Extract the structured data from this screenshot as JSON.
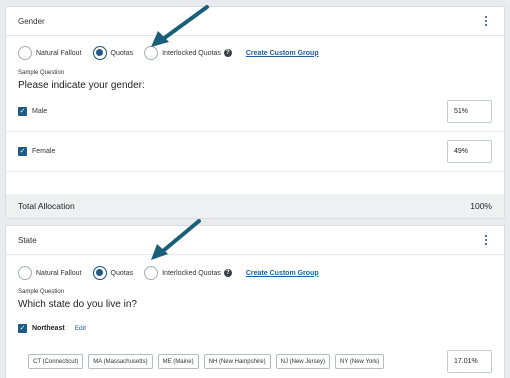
{
  "gender_card": {
    "title": "Gender",
    "options": {
      "natural_fallout": "Natural Fallout",
      "quotas": "Quotas",
      "interlocked": "Interlocked Quotas"
    },
    "help_glyph": "?",
    "custom_group_link": "Create Custom Group",
    "sample_label": "Sample Question",
    "question": "Please indicate your gender:",
    "answers": [
      {
        "label": "Male",
        "checked": true,
        "value": "51%"
      },
      {
        "label": "Female",
        "checked": true,
        "value": "49%"
      }
    ],
    "total_label": "Total Allocation",
    "total_value": "100%"
  },
  "state_card": {
    "title": "State",
    "options": {
      "natural_fallout": "Natural Fallout",
      "quotas": "Quotas",
      "interlocked": "Interlocked Quotas"
    },
    "help_glyph": "?",
    "custom_group_link": "Create Custom Group",
    "sample_label": "Sample Question",
    "question": "Which state do you live in?",
    "region": {
      "name": "Northeast",
      "edit_label": "Edit",
      "checked": true
    },
    "states": [
      "CT (Connecticut)",
      "MA (Massachusetts)",
      "ME (Maine)",
      "NH (New Hampshire)",
      "NJ (New Jersey)",
      "NY (New York)"
    ],
    "region_value": "17.01%"
  },
  "selected_mode": "Quotas",
  "icons": [
    "kebab-menu-icon",
    "help-icon",
    "checkmark-icon",
    "arrow-annotation-icon"
  ],
  "colors": {
    "accent": "#1f5a86",
    "link": "#1f5da0",
    "arrow": "#1a5f7a"
  }
}
